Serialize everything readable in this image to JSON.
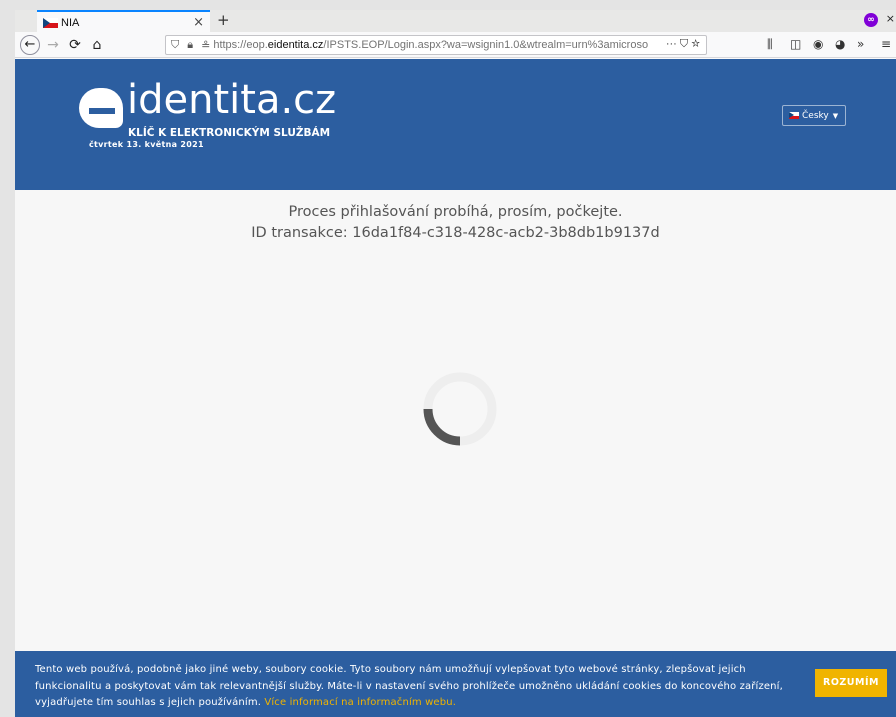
{
  "browser": {
    "tab_title": "NIA",
    "tab_close": "×",
    "new_tab": "+",
    "url_host": "https://eop.",
    "url_domain": "eidentita.cz",
    "url_path": "/IPSTS.EOP/Login.aspx?wa=wsignin1.0&wtrealm=urn%3amicroso",
    "url_actions": "··· ⛉ ☆",
    "win_close": "×",
    "ext_label": "∞"
  },
  "header": {
    "logo_text": "identita.cz",
    "logo_sub": "KLÍČ K ELEKTRONICKÝM SLUŽBÁM",
    "date": "čtvrtek 13. května 2021",
    "language": "Česky"
  },
  "main": {
    "line1": "Proces přihlašování probíhá, prosím, počkejte.",
    "line2": "ID transakce: 16da1f84-c318-428c-acb2-3b8db1b9137d"
  },
  "cookie": {
    "text": "Tento web používá, podobně jako jiné weby, soubory cookie. Tyto soubory nám umožňují vylepšovat tyto webové stránky, zlepšovat jejich funkcionalitu a poskytovat vám tak relevantnější služby. Máte-li v nastavení svého prohlížeče umožněno ukládání cookies do koncového zařízení, vyjadřujete tím souhlas s jejich používáním.",
    "link": "Více informací na informačním webu.",
    "button": "ROZUMÍM"
  },
  "colors": {
    "brand_blue": "#2c5ea0",
    "accent_yellow": "#f0b400"
  }
}
